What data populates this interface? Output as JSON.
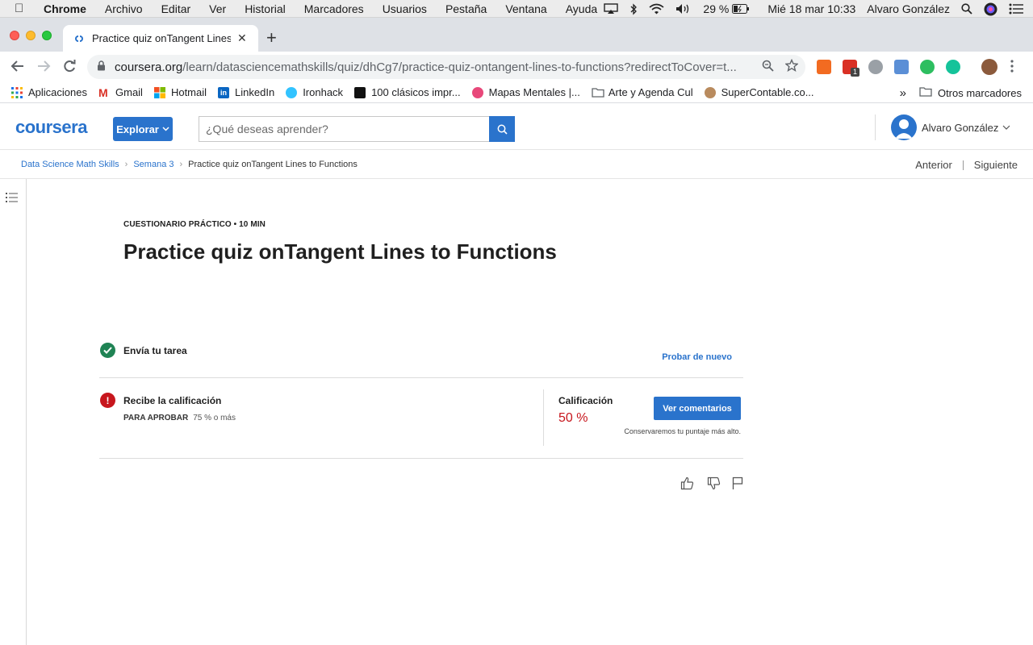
{
  "mac_menu": {
    "app": "Chrome",
    "items": [
      "Archivo",
      "Editar",
      "Ver",
      "Historial",
      "Marcadores",
      "Usuarios",
      "Pestaña",
      "Ventana",
      "Ayuda"
    ],
    "battery": "29 %",
    "clock": "Mié 18 mar  10:33",
    "user": "Alvaro González"
  },
  "browser": {
    "tab_title": "Practice quiz onTangent Lines",
    "url_host": "coursera.org",
    "url_path": "/learn/datasciencemathskills/quiz/dhCg7/practice-quiz-ontangent-lines-to-functions?redirectToCover=t...",
    "ext_badge": "1"
  },
  "bookmarks": {
    "items": [
      "Aplicaciones",
      "Gmail",
      "Hotmail",
      "LinkedIn",
      "Ironhack",
      "100 clásicos impr...",
      "Mapas Mentales |...",
      "Arte y Agenda Cul",
      "SuperContable.co..."
    ],
    "overflow": "»",
    "other": "Otros marcadores"
  },
  "header": {
    "logo": "coursera",
    "explore": "Explorar",
    "search_placeholder": "¿Qué deseas aprender?",
    "user": "Alvaro González"
  },
  "breadcrumb": {
    "course": "Data Science Math Skills",
    "week": "Semana 3",
    "current": "Practice quiz onTangent Lines to Functions",
    "prev": "Anterior",
    "next": "Siguiente"
  },
  "quiz": {
    "eyebrow": "CUESTIONARIO PRÁCTICO • 10 MIN",
    "title": "Practice quiz onTangent Lines to Functions",
    "submit_label": "Envía tu tarea",
    "retry": "Probar de nuevo",
    "receive_label": "Recibe la calificación",
    "pass_label": "PARA APROBAR",
    "pass_value": "75 % o más",
    "grade_label": "Calificación",
    "grade_value": "50 %",
    "feedback_button": "Ver comentarios",
    "keep_note": "Conservaremos tu puntaje más alto."
  },
  "colors": {
    "accent": "#2a73cc",
    "success": "#1f8354",
    "error": "#c7161d"
  },
  "icons": {
    "submitted": "check-circle-icon",
    "grade_status": "exclamation-circle-icon",
    "like": "thumbs-up-icon",
    "dislike": "thumbs-down-icon",
    "report": "flag-icon"
  }
}
